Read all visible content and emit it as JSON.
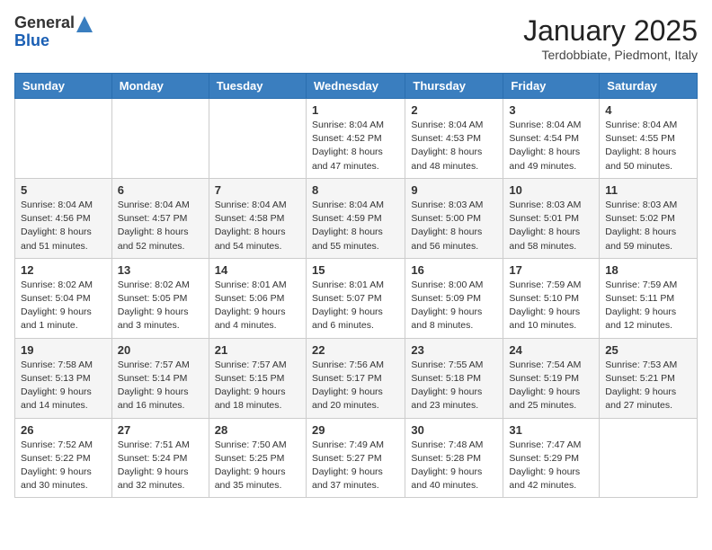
{
  "logo": {
    "general": "General",
    "blue": "Blue"
  },
  "header": {
    "month": "January 2025",
    "location": "Terdobbiate, Piedmont, Italy"
  },
  "weekdays": [
    "Sunday",
    "Monday",
    "Tuesday",
    "Wednesday",
    "Thursday",
    "Friday",
    "Saturday"
  ],
  "weeks": [
    [
      {
        "day": "",
        "info": ""
      },
      {
        "day": "",
        "info": ""
      },
      {
        "day": "",
        "info": ""
      },
      {
        "day": "1",
        "info": "Sunrise: 8:04 AM\nSunset: 4:52 PM\nDaylight: 8 hours and 47 minutes."
      },
      {
        "day": "2",
        "info": "Sunrise: 8:04 AM\nSunset: 4:53 PM\nDaylight: 8 hours and 48 minutes."
      },
      {
        "day": "3",
        "info": "Sunrise: 8:04 AM\nSunset: 4:54 PM\nDaylight: 8 hours and 49 minutes."
      },
      {
        "day": "4",
        "info": "Sunrise: 8:04 AM\nSunset: 4:55 PM\nDaylight: 8 hours and 50 minutes."
      }
    ],
    [
      {
        "day": "5",
        "info": "Sunrise: 8:04 AM\nSunset: 4:56 PM\nDaylight: 8 hours and 51 minutes."
      },
      {
        "day": "6",
        "info": "Sunrise: 8:04 AM\nSunset: 4:57 PM\nDaylight: 8 hours and 52 minutes."
      },
      {
        "day": "7",
        "info": "Sunrise: 8:04 AM\nSunset: 4:58 PM\nDaylight: 8 hours and 54 minutes."
      },
      {
        "day": "8",
        "info": "Sunrise: 8:04 AM\nSunset: 4:59 PM\nDaylight: 8 hours and 55 minutes."
      },
      {
        "day": "9",
        "info": "Sunrise: 8:03 AM\nSunset: 5:00 PM\nDaylight: 8 hours and 56 minutes."
      },
      {
        "day": "10",
        "info": "Sunrise: 8:03 AM\nSunset: 5:01 PM\nDaylight: 8 hours and 58 minutes."
      },
      {
        "day": "11",
        "info": "Sunrise: 8:03 AM\nSunset: 5:02 PM\nDaylight: 8 hours and 59 minutes."
      }
    ],
    [
      {
        "day": "12",
        "info": "Sunrise: 8:02 AM\nSunset: 5:04 PM\nDaylight: 9 hours and 1 minute."
      },
      {
        "day": "13",
        "info": "Sunrise: 8:02 AM\nSunset: 5:05 PM\nDaylight: 9 hours and 3 minutes."
      },
      {
        "day": "14",
        "info": "Sunrise: 8:01 AM\nSunset: 5:06 PM\nDaylight: 9 hours and 4 minutes."
      },
      {
        "day": "15",
        "info": "Sunrise: 8:01 AM\nSunset: 5:07 PM\nDaylight: 9 hours and 6 minutes."
      },
      {
        "day": "16",
        "info": "Sunrise: 8:00 AM\nSunset: 5:09 PM\nDaylight: 9 hours and 8 minutes."
      },
      {
        "day": "17",
        "info": "Sunrise: 7:59 AM\nSunset: 5:10 PM\nDaylight: 9 hours and 10 minutes."
      },
      {
        "day": "18",
        "info": "Sunrise: 7:59 AM\nSunset: 5:11 PM\nDaylight: 9 hours and 12 minutes."
      }
    ],
    [
      {
        "day": "19",
        "info": "Sunrise: 7:58 AM\nSunset: 5:13 PM\nDaylight: 9 hours and 14 minutes."
      },
      {
        "day": "20",
        "info": "Sunrise: 7:57 AM\nSunset: 5:14 PM\nDaylight: 9 hours and 16 minutes."
      },
      {
        "day": "21",
        "info": "Sunrise: 7:57 AM\nSunset: 5:15 PM\nDaylight: 9 hours and 18 minutes."
      },
      {
        "day": "22",
        "info": "Sunrise: 7:56 AM\nSunset: 5:17 PM\nDaylight: 9 hours and 20 minutes."
      },
      {
        "day": "23",
        "info": "Sunrise: 7:55 AM\nSunset: 5:18 PM\nDaylight: 9 hours and 23 minutes."
      },
      {
        "day": "24",
        "info": "Sunrise: 7:54 AM\nSunset: 5:19 PM\nDaylight: 9 hours and 25 minutes."
      },
      {
        "day": "25",
        "info": "Sunrise: 7:53 AM\nSunset: 5:21 PM\nDaylight: 9 hours and 27 minutes."
      }
    ],
    [
      {
        "day": "26",
        "info": "Sunrise: 7:52 AM\nSunset: 5:22 PM\nDaylight: 9 hours and 30 minutes."
      },
      {
        "day": "27",
        "info": "Sunrise: 7:51 AM\nSunset: 5:24 PM\nDaylight: 9 hours and 32 minutes."
      },
      {
        "day": "28",
        "info": "Sunrise: 7:50 AM\nSunset: 5:25 PM\nDaylight: 9 hours and 35 minutes."
      },
      {
        "day": "29",
        "info": "Sunrise: 7:49 AM\nSunset: 5:27 PM\nDaylight: 9 hours and 37 minutes."
      },
      {
        "day": "30",
        "info": "Sunrise: 7:48 AM\nSunset: 5:28 PM\nDaylight: 9 hours and 40 minutes."
      },
      {
        "day": "31",
        "info": "Sunrise: 7:47 AM\nSunset: 5:29 PM\nDaylight: 9 hours and 42 minutes."
      },
      {
        "day": "",
        "info": ""
      }
    ]
  ]
}
